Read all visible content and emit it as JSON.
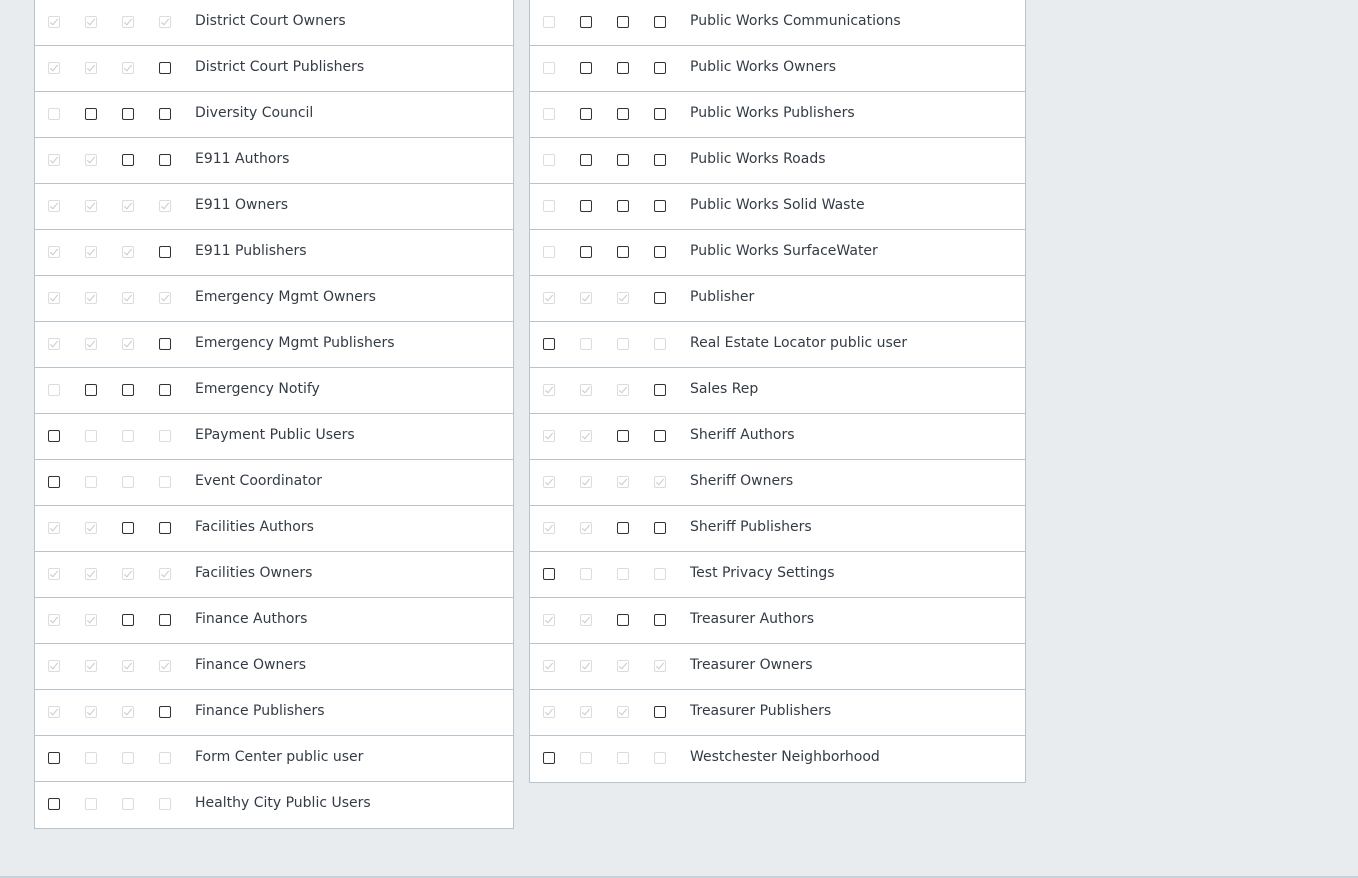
{
  "left_rows": [
    {
      "label": "District Court Owners",
      "boxes": [
        "cd",
        "cd",
        "cd",
        "cd"
      ]
    },
    {
      "label": "District Court Publishers",
      "boxes": [
        "cd",
        "cd",
        "cd",
        "u"
      ]
    },
    {
      "label": "Diversity Council",
      "boxes": [
        "d",
        "u",
        "u",
        "u"
      ]
    },
    {
      "label": "E911 Authors",
      "boxes": [
        "cd",
        "cd",
        "u",
        "u"
      ]
    },
    {
      "label": "E911 Owners",
      "boxes": [
        "cd",
        "cd",
        "cd",
        "cd"
      ]
    },
    {
      "label": "E911 Publishers",
      "boxes": [
        "cd",
        "cd",
        "cd",
        "u"
      ]
    },
    {
      "label": "Emergency Mgmt Owners",
      "boxes": [
        "cd",
        "cd",
        "cd",
        "cd"
      ]
    },
    {
      "label": "Emergency Mgmt Publishers",
      "boxes": [
        "cd",
        "cd",
        "cd",
        "u"
      ]
    },
    {
      "label": "Emergency Notify",
      "boxes": [
        "d",
        "u",
        "u",
        "u"
      ]
    },
    {
      "label": "EPayment Public Users",
      "boxes": [
        "u",
        "d",
        "d",
        "d"
      ]
    },
    {
      "label": "Event Coordinator",
      "boxes": [
        "u",
        "d",
        "d",
        "d"
      ]
    },
    {
      "label": "Facilities Authors",
      "boxes": [
        "cd",
        "cd",
        "u",
        "u"
      ]
    },
    {
      "label": "Facilities Owners",
      "boxes": [
        "cd",
        "cd",
        "cd",
        "cd"
      ]
    },
    {
      "label": "Finance Authors",
      "boxes": [
        "cd",
        "cd",
        "u",
        "u"
      ]
    },
    {
      "label": "Finance Owners",
      "boxes": [
        "cd",
        "cd",
        "cd",
        "cd"
      ]
    },
    {
      "label": "Finance Publishers",
      "boxes": [
        "cd",
        "cd",
        "cd",
        "u"
      ]
    },
    {
      "label": "Form Center public user",
      "boxes": [
        "u",
        "d",
        "d",
        "d"
      ]
    },
    {
      "label": "Healthy City Public Users",
      "boxes": [
        "u",
        "d",
        "d",
        "d"
      ]
    }
  ],
  "right_rows": [
    {
      "label": "Public Works Communications",
      "boxes": [
        "d",
        "u",
        "u",
        "u"
      ]
    },
    {
      "label": "Public Works Owners",
      "boxes": [
        "d",
        "u",
        "u",
        "u"
      ]
    },
    {
      "label": "Public Works Publishers",
      "boxes": [
        "d",
        "u",
        "u",
        "u"
      ]
    },
    {
      "label": "Public Works Roads",
      "boxes": [
        "d",
        "u",
        "u",
        "u"
      ]
    },
    {
      "label": "Public Works Solid Waste",
      "boxes": [
        "d",
        "u",
        "u",
        "u"
      ]
    },
    {
      "label": "Public Works SurfaceWater",
      "boxes": [
        "d",
        "u",
        "u",
        "u"
      ]
    },
    {
      "label": "Publisher",
      "boxes": [
        "cd",
        "cd",
        "cd",
        "u"
      ]
    },
    {
      "label": "Real Estate Locator public user",
      "boxes": [
        "u",
        "d",
        "d",
        "d"
      ]
    },
    {
      "label": "Sales Rep",
      "boxes": [
        "cd",
        "cd",
        "cd",
        "u"
      ]
    },
    {
      "label": "Sheriff Authors",
      "boxes": [
        "cd",
        "cd",
        "u",
        "u"
      ]
    },
    {
      "label": "Sheriff Owners",
      "boxes": [
        "cd",
        "cd",
        "cd",
        "cd"
      ]
    },
    {
      "label": "Sheriff Publishers",
      "boxes": [
        "cd",
        "cd",
        "u",
        "u"
      ]
    },
    {
      "label": "Test Privacy Settings",
      "boxes": [
        "u",
        "d",
        "d",
        "d"
      ]
    },
    {
      "label": "Treasurer Authors",
      "boxes": [
        "cd",
        "cd",
        "u",
        "u"
      ]
    },
    {
      "label": "Treasurer Owners",
      "boxes": [
        "cd",
        "cd",
        "cd",
        "cd"
      ]
    },
    {
      "label": "Treasurer Publishers",
      "boxes": [
        "cd",
        "cd",
        "cd",
        "u"
      ]
    },
    {
      "label": "Westchester Neighborhood",
      "boxes": [
        "u",
        "d",
        "d",
        "d"
      ]
    }
  ]
}
